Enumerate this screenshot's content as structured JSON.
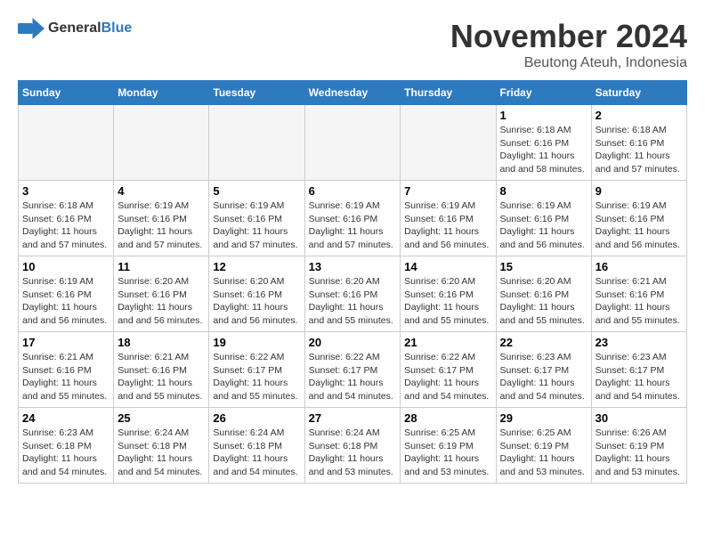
{
  "logo": {
    "text_general": "General",
    "text_blue": "Blue"
  },
  "title": "November 2024",
  "location": "Beutong Ateuh, Indonesia",
  "days_of_week": [
    "Sunday",
    "Monday",
    "Tuesday",
    "Wednesday",
    "Thursday",
    "Friday",
    "Saturday"
  ],
  "weeks": [
    [
      {
        "day": "",
        "content": ""
      },
      {
        "day": "",
        "content": ""
      },
      {
        "day": "",
        "content": ""
      },
      {
        "day": "",
        "content": ""
      },
      {
        "day": "",
        "content": ""
      },
      {
        "day": "1",
        "content": "Sunrise: 6:18 AM\nSunset: 6:16 PM\nDaylight: 11 hours and 58 minutes."
      },
      {
        "day": "2",
        "content": "Sunrise: 6:18 AM\nSunset: 6:16 PM\nDaylight: 11 hours and 57 minutes."
      }
    ],
    [
      {
        "day": "3",
        "content": "Sunrise: 6:18 AM\nSunset: 6:16 PM\nDaylight: 11 hours and 57 minutes."
      },
      {
        "day": "4",
        "content": "Sunrise: 6:19 AM\nSunset: 6:16 PM\nDaylight: 11 hours and 57 minutes."
      },
      {
        "day": "5",
        "content": "Sunrise: 6:19 AM\nSunset: 6:16 PM\nDaylight: 11 hours and 57 minutes."
      },
      {
        "day": "6",
        "content": "Sunrise: 6:19 AM\nSunset: 6:16 PM\nDaylight: 11 hours and 57 minutes."
      },
      {
        "day": "7",
        "content": "Sunrise: 6:19 AM\nSunset: 6:16 PM\nDaylight: 11 hours and 56 minutes."
      },
      {
        "day": "8",
        "content": "Sunrise: 6:19 AM\nSunset: 6:16 PM\nDaylight: 11 hours and 56 minutes."
      },
      {
        "day": "9",
        "content": "Sunrise: 6:19 AM\nSunset: 6:16 PM\nDaylight: 11 hours and 56 minutes."
      }
    ],
    [
      {
        "day": "10",
        "content": "Sunrise: 6:19 AM\nSunset: 6:16 PM\nDaylight: 11 hours and 56 minutes."
      },
      {
        "day": "11",
        "content": "Sunrise: 6:20 AM\nSunset: 6:16 PM\nDaylight: 11 hours and 56 minutes."
      },
      {
        "day": "12",
        "content": "Sunrise: 6:20 AM\nSunset: 6:16 PM\nDaylight: 11 hours and 56 minutes."
      },
      {
        "day": "13",
        "content": "Sunrise: 6:20 AM\nSunset: 6:16 PM\nDaylight: 11 hours and 55 minutes."
      },
      {
        "day": "14",
        "content": "Sunrise: 6:20 AM\nSunset: 6:16 PM\nDaylight: 11 hours and 55 minutes."
      },
      {
        "day": "15",
        "content": "Sunrise: 6:20 AM\nSunset: 6:16 PM\nDaylight: 11 hours and 55 minutes."
      },
      {
        "day": "16",
        "content": "Sunrise: 6:21 AM\nSunset: 6:16 PM\nDaylight: 11 hours and 55 minutes."
      }
    ],
    [
      {
        "day": "17",
        "content": "Sunrise: 6:21 AM\nSunset: 6:16 PM\nDaylight: 11 hours and 55 minutes."
      },
      {
        "day": "18",
        "content": "Sunrise: 6:21 AM\nSunset: 6:16 PM\nDaylight: 11 hours and 55 minutes."
      },
      {
        "day": "19",
        "content": "Sunrise: 6:22 AM\nSunset: 6:17 PM\nDaylight: 11 hours and 55 minutes."
      },
      {
        "day": "20",
        "content": "Sunrise: 6:22 AM\nSunset: 6:17 PM\nDaylight: 11 hours and 54 minutes."
      },
      {
        "day": "21",
        "content": "Sunrise: 6:22 AM\nSunset: 6:17 PM\nDaylight: 11 hours and 54 minutes."
      },
      {
        "day": "22",
        "content": "Sunrise: 6:23 AM\nSunset: 6:17 PM\nDaylight: 11 hours and 54 minutes."
      },
      {
        "day": "23",
        "content": "Sunrise: 6:23 AM\nSunset: 6:17 PM\nDaylight: 11 hours and 54 minutes."
      }
    ],
    [
      {
        "day": "24",
        "content": "Sunrise: 6:23 AM\nSunset: 6:18 PM\nDaylight: 11 hours and 54 minutes."
      },
      {
        "day": "25",
        "content": "Sunrise: 6:24 AM\nSunset: 6:18 PM\nDaylight: 11 hours and 54 minutes."
      },
      {
        "day": "26",
        "content": "Sunrise: 6:24 AM\nSunset: 6:18 PM\nDaylight: 11 hours and 54 minutes."
      },
      {
        "day": "27",
        "content": "Sunrise: 6:24 AM\nSunset: 6:18 PM\nDaylight: 11 hours and 53 minutes."
      },
      {
        "day": "28",
        "content": "Sunrise: 6:25 AM\nSunset: 6:19 PM\nDaylight: 11 hours and 53 minutes."
      },
      {
        "day": "29",
        "content": "Sunrise: 6:25 AM\nSunset: 6:19 PM\nDaylight: 11 hours and 53 minutes."
      },
      {
        "day": "30",
        "content": "Sunrise: 6:26 AM\nSunset: 6:19 PM\nDaylight: 11 hours and 53 minutes."
      }
    ]
  ]
}
